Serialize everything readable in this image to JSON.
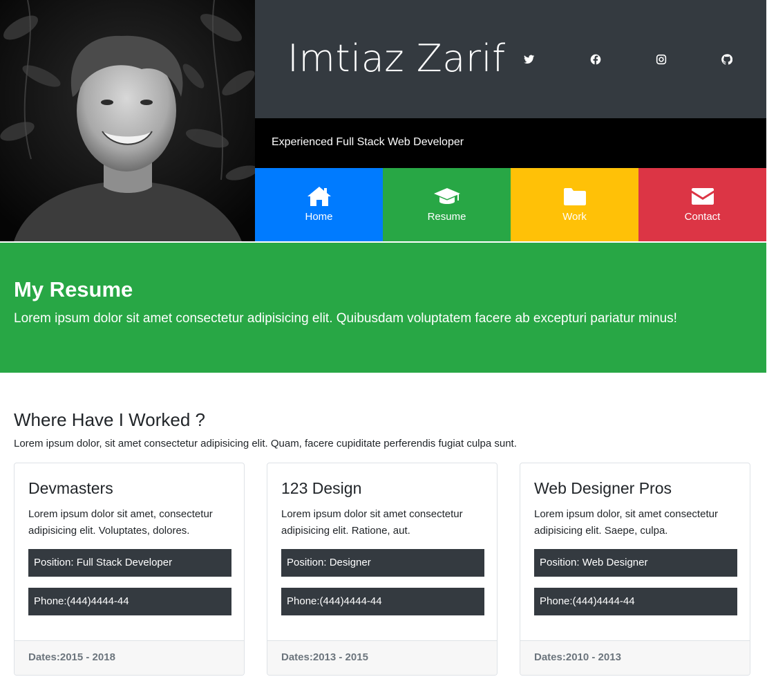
{
  "profile": {
    "name": "Imtiaz Zarif",
    "tagline": "Experienced Full Stack Web Developer",
    "photo_alt": "portrait-photo"
  },
  "social": [
    {
      "name": "twitter-icon",
      "label": "Twitter"
    },
    {
      "name": "facebook-icon",
      "label": "Facebook"
    },
    {
      "name": "instagram-icon",
      "label": "Instagram"
    },
    {
      "name": "github-icon",
      "label": "GitHub"
    }
  ],
  "nav": [
    {
      "label": "Home",
      "icon": "home-icon",
      "color": "#007bff"
    },
    {
      "label": "Resume",
      "icon": "graduation-cap-icon",
      "color": "#28a745"
    },
    {
      "label": "Work",
      "icon": "folder-icon",
      "color": "#ffc107"
    },
    {
      "label": "Contact",
      "icon": "envelope-icon",
      "color": "#dc3545"
    }
  ],
  "banner": {
    "title": "My Resume",
    "text": "Lorem ipsum dolor sit amet consectetur adipisicing elit. Quibusdam voluptatem facere ab excepturi pariatur minus!",
    "color": "#28a745"
  },
  "work": {
    "title": "Where Have I Worked ?",
    "text": "Lorem ipsum dolor, sit amet consectetur adipisicing elit. Quam, facere cupiditate perferendis fugiat culpa sunt.",
    "cards": [
      {
        "title": "Devmasters",
        "text": "Lorem ipsum dolor sit amet, consectetur adipisicing elit. Voluptates, dolores.",
        "position": "Position: Full Stack Developer",
        "phone": "Phone:(444)4444-44",
        "dates": "Dates:2015 - 2018"
      },
      {
        "title": "123 Design",
        "text": "Lorem ipsum dolor sit amet consectetur adipisicing elit. Ratione, aut.",
        "position": "Position: Designer",
        "phone": "Phone:(444)4444-44",
        "dates": "Dates:2013 - 2015"
      },
      {
        "title": "Web Designer Pros",
        "text": "Lorem ipsum dolor, sit amet consectetur adipisicing elit. Saepe, culpa.",
        "position": "Position: Web Designer",
        "phone": "Phone:(444)4444-44",
        "dates": "Dates:2010 - 2013"
      }
    ]
  },
  "colors": {
    "dark": "#343a40",
    "black": "#000000",
    "primary": "#007bff",
    "success": "#28a745",
    "warning": "#ffc107",
    "danger": "#dc3545"
  }
}
